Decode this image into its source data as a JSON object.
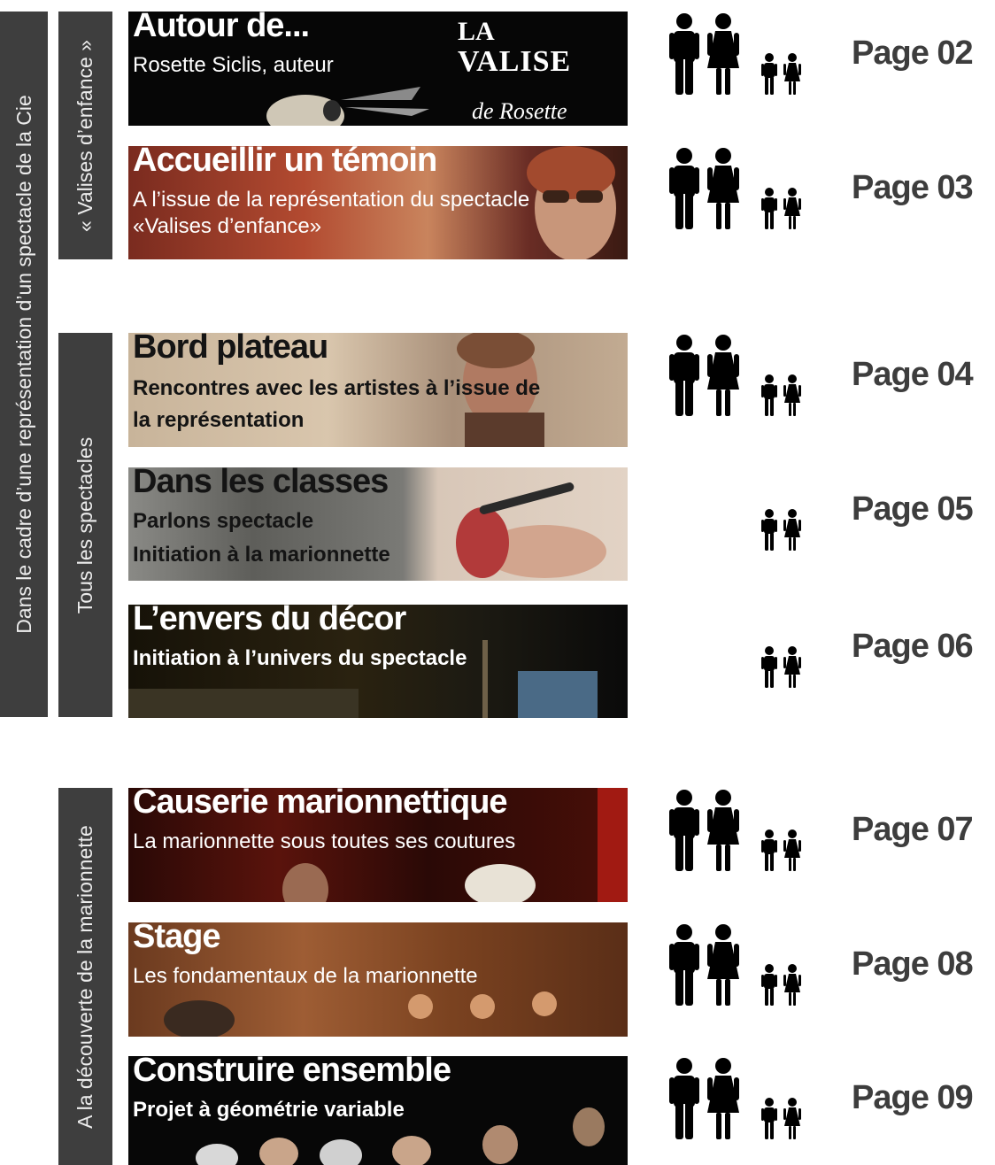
{
  "colors": {
    "bar": "#3e3e3e",
    "page_text": "#3d3d3d"
  },
  "sidebars": {
    "outer": "Dans le cadre d’une représentation d’un spectacle de la Cie",
    "valises": "« Valises d’enfance »",
    "tous": "Tous les spectacles",
    "decouverte": "A la découverte de la marionnette"
  },
  "cards": [
    {
      "title": "Autour de...",
      "subtitle": "Rosette Siclis, auteur",
      "logo_line1": "LA",
      "logo_line2": "VALISE",
      "logo_line3": "de Rosette"
    },
    {
      "title": "Accueillir un témoin",
      "subtitle_l1": "A l’issue de la représentation du spectacle",
      "subtitle_l2": "«Valises d’enfance»"
    },
    {
      "title": "Bord plateau",
      "subtitle_l1": "Rencontres avec les artistes à l’issue de",
      "subtitle_l2": "la représentation"
    },
    {
      "title": "Dans les classes",
      "subtitle_l1": "Parlons spectacle",
      "subtitle_l2": "Initiation à la marionnette"
    },
    {
      "title": "L’envers du décor",
      "subtitle": "Initiation à l’univers du spectacle"
    },
    {
      "title": "Causerie marionnettique",
      "subtitle": "La marionnette sous toutes ses coutures"
    },
    {
      "title": "Stage",
      "subtitle": "Les fondamentaux de la marionnette"
    },
    {
      "title": "Construire ensemble",
      "subtitle": "Projet à géométrie variable"
    }
  ],
  "pages": [
    {
      "label": "Page 02",
      "audience": "adults-children"
    },
    {
      "label": "Page 03",
      "audience": "adults-children"
    },
    {
      "label": "Page 04",
      "audience": "adults-children"
    },
    {
      "label": "Page 05",
      "audience": "children"
    },
    {
      "label": "Page 06",
      "audience": "children"
    },
    {
      "label": "Page 07",
      "audience": "adults-children"
    },
    {
      "label": "Page 08",
      "audience": "adults-children"
    },
    {
      "label": "Page 09",
      "audience": "adults-children"
    }
  ]
}
